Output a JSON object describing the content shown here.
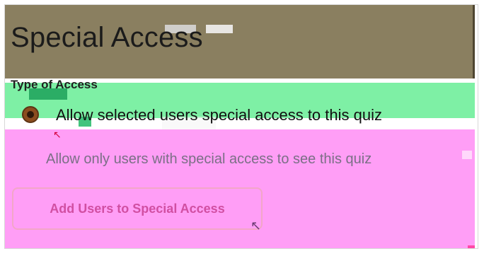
{
  "page": {
    "title": "Special Access"
  },
  "section": {
    "type_label": "Type of Access"
  },
  "options": {
    "option_1_label": "Allow selected users special access to this quiz",
    "option_2_label": "Allow only users with special access to see this quiz"
  },
  "actions": {
    "add_users_label": "Add Users to Special Access"
  },
  "colors": {
    "header_band": "#8a7f60",
    "green_band": "#7ef0a5",
    "pink_area": "#ff9ef6",
    "button_text": "#d14fa2",
    "radio_fill": "#8b4d1f"
  },
  "icons": {
    "radio_selected": "radio-selected-icon",
    "cursor": "cursor-icon"
  }
}
